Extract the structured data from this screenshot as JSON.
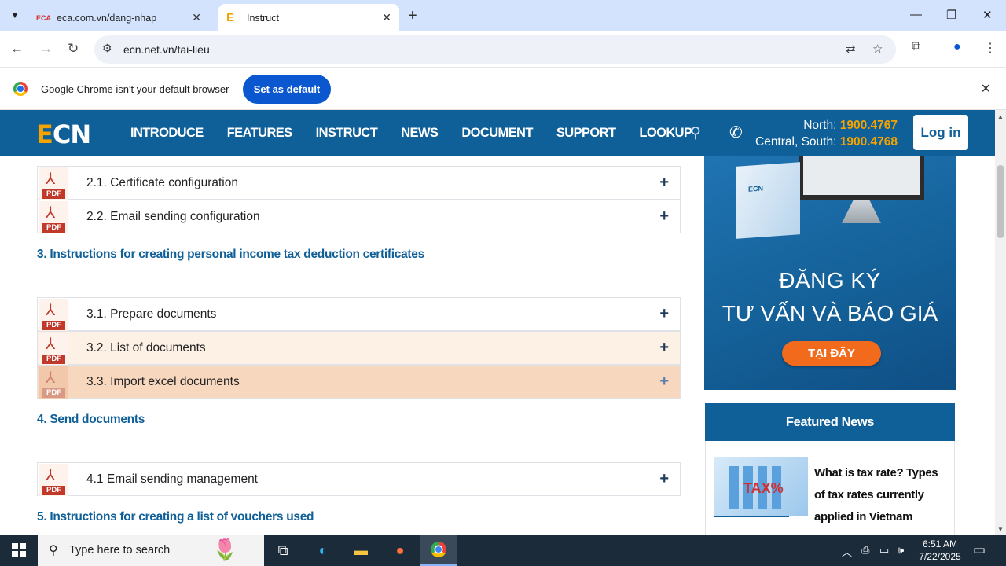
{
  "browser": {
    "tabs": [
      {
        "favicon": "ECA",
        "title": "eca.com.vn/dang-nhap",
        "active": false
      },
      {
        "favicon": "E",
        "title": "Instruct",
        "active": true
      }
    ],
    "url": "ecn.net.vn/tai-lieu"
  },
  "infobar": {
    "message": "Google Chrome isn't your default browser",
    "button": "Set as default"
  },
  "site": {
    "logo_e": "E",
    "logo_rest": "CN",
    "menu": [
      "INTRODUCE",
      "FEATURES",
      "INSTRUCT",
      "NEWS",
      "DOCUMENT",
      "SUPPORT",
      "LOOKUP"
    ],
    "hotline_north_label": "North:",
    "hotline_north": "1900.4767",
    "hotline_south_label": "Central, South:",
    "hotline_south": "1900.4768",
    "login": "Log in"
  },
  "doc": {
    "pdf_label": "PDF",
    "rows_a": [
      {
        "title": "2.1. Certificate configuration"
      },
      {
        "title": "2.2. Email sending configuration"
      }
    ],
    "section3": "3. Instructions for creating personal income tax deduction certificates",
    "rows_b": [
      {
        "title": "3.1. Prepare documents"
      },
      {
        "title": "3.2. List of documents"
      },
      {
        "title": "3.3. Import excel documents"
      }
    ],
    "section4": "4. Send documents",
    "rows_c": [
      {
        "title": "4.1 Email sending management"
      }
    ],
    "section5": "5. Instructions for creating a list of vouchers used"
  },
  "sidebar": {
    "banner_line1": "ĐĂNG KÝ",
    "banner_line2": "TƯ VẤN VÀ BÁO GIÁ",
    "banner_cta": "TẠI ĐÂY",
    "box_label": "ECN",
    "featured_title": "Featured News",
    "news_title": "What is tax rate? Types of tax rates currently applied in Vietnam",
    "thumb_text": "TAX%"
  },
  "taskbar": {
    "search_placeholder": "Type here to search",
    "time": "6:51 AM",
    "date": "7/22/2025"
  }
}
